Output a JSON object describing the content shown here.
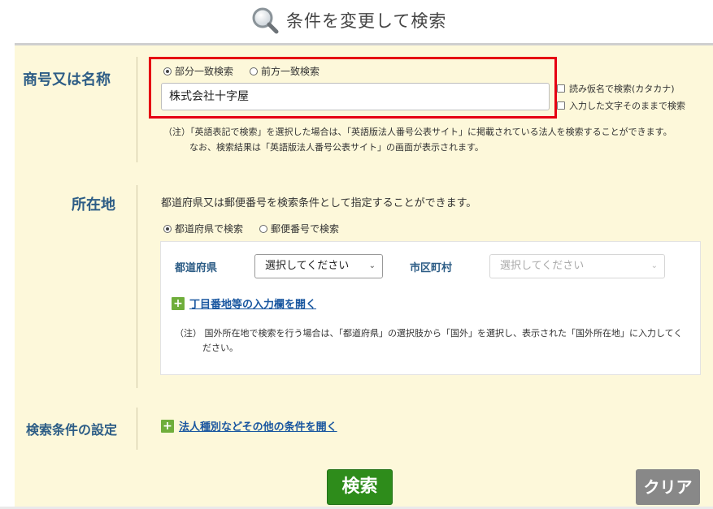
{
  "header": {
    "title": "条件を変更して検索",
    "icon": "magnifier-icon"
  },
  "name_section": {
    "label": "商号又は名称",
    "radio_partial": "部分一致検索",
    "radio_prefix": "前方一致検索",
    "selected": "部分一致検索",
    "input_value": "株式会社十字屋",
    "checkbox_kana": "読み仮名で検索(カタカナ)",
    "checkbox_exact": "入力した文字そのままで検索",
    "note_line1": "（注）「英語表記で検索」を選択した場合は、「英語版法人番号公表サイト」に掲載されている法人を検索することができます。",
    "note_line2": "なお、検索結果は「英語版法人番号公表サイト」の画面が表示されます。"
  },
  "location_section": {
    "label": "所在地",
    "description": "都道府県又は郵便番号を検索条件として指定することができます。",
    "radio_prefecture": "都道府県で検索",
    "radio_postal": "郵便番号で検索",
    "selected": "都道府県で検索",
    "prefecture_label": "都道府県",
    "prefecture_select": "選択してください",
    "city_label": "市区町村",
    "city_select": "選択してください",
    "expand_address": "丁目番地等の入力欄を開く",
    "note_line1": "（注） 国外所在地で検索を行う場合は、「都道府県」の選択肢から「国外」を選択し、表示された「国外所在地」に入力してく",
    "note_line2": "ださい。"
  },
  "conditions_section": {
    "label": "検索条件の設定",
    "expand_label": "法人種別などその他の条件を開く"
  },
  "buttons": {
    "search": "検索",
    "clear": "クリア"
  },
  "colors": {
    "label_blue": "#2d5d86",
    "panel_bg": "#fdf8da",
    "accent_green": "#2e8c1b",
    "highlight_red": "#e60012"
  }
}
